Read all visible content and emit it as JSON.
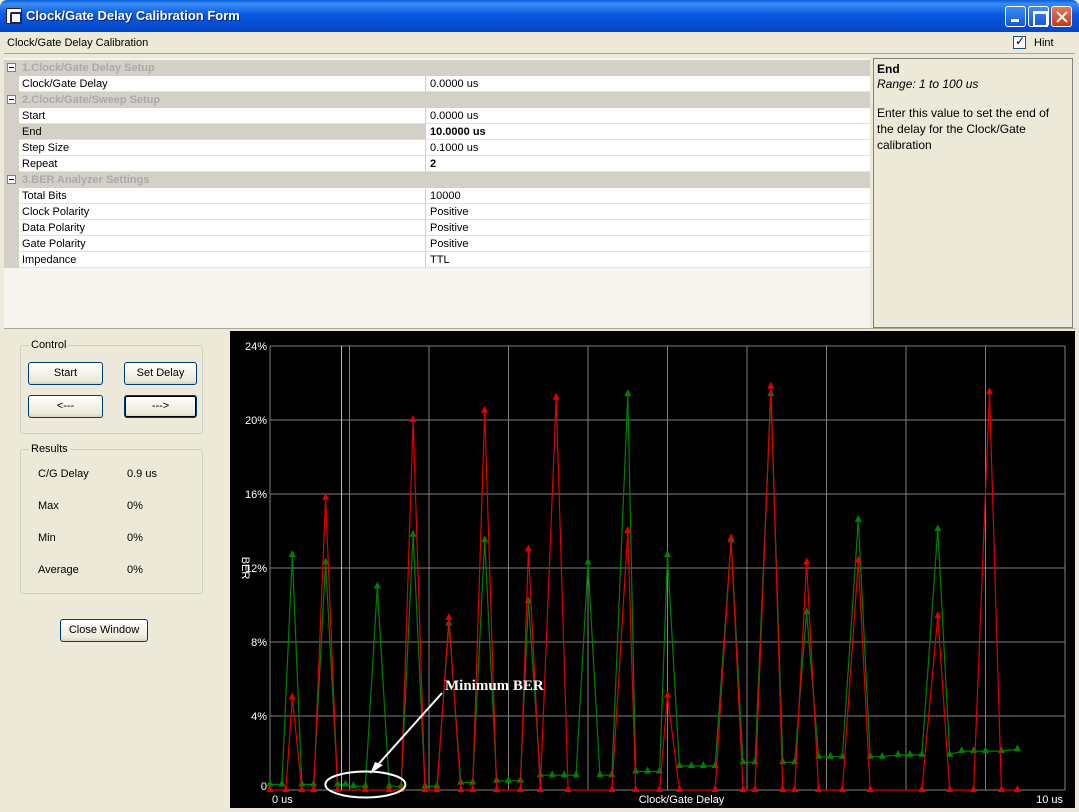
{
  "window": {
    "title": "Clock/Gate Delay Calibration Form"
  },
  "header": {
    "title": "Clock/Gate Delay Calibration",
    "hint_label": "Hint",
    "hint_checked": true
  },
  "propgrid": {
    "categories": [
      {
        "label": "1.Clock/Gate Delay Setup",
        "props": [
          {
            "name": "Clock/Gate Delay",
            "value": "0.0000 us"
          }
        ]
      },
      {
        "label": "2.Clock/Gate/Sweep Setup",
        "props": [
          {
            "name": "Start",
            "value": "0.0000 us"
          },
          {
            "name": "End",
            "value": "10.0000 us",
            "selected": true,
            "bold": true
          },
          {
            "name": "Step Size",
            "value": "0.1000 us"
          },
          {
            "name": "Repeat",
            "value": "2",
            "bold": true
          }
        ]
      },
      {
        "label": "3.BER Analyzer Settings",
        "props": [
          {
            "name": "Total Bits",
            "value": "10000"
          },
          {
            "name": "Clock Polarity",
            "value": "Positive"
          },
          {
            "name": "Data Polarity",
            "value": "Positive"
          },
          {
            "name": "Gate Polarity",
            "value": "Positive"
          },
          {
            "name": "Impedance",
            "value": "TTL"
          }
        ]
      }
    ]
  },
  "hint_panel": {
    "title": "End",
    "range": "Range: 1 to 100 us",
    "description": "Enter this value to set the end of the delay for the Clock/Gate calibration"
  },
  "control": {
    "title": "Control",
    "start_label": "Start",
    "set_delay_label": "Set Delay",
    "prev_label": "<---",
    "next_label": "--->"
  },
  "results": {
    "title": "Results",
    "items": [
      {
        "label": "C/G Delay",
        "value": "0.9 us"
      },
      {
        "label": "Max",
        "value": "0%"
      },
      {
        "label": "Min",
        "value": "0%"
      },
      {
        "label": "Average",
        "value": "0%"
      }
    ]
  },
  "close_button_label": "Close Window",
  "chart_data": {
    "type": "line",
    "xlabel": "Clock/Gate Delay",
    "ylabel": "BER",
    "xlim": [
      0,
      10
    ],
    "ylim": [
      0,
      24
    ],
    "x_tick_labels": [
      "0 us",
      "10 us"
    ],
    "y_ticks": [
      "0",
      "4%",
      "8%",
      "12%",
      "16%",
      "20%",
      "24%"
    ],
    "grid": true,
    "annotation": "Minimum BER",
    "marker_x": 0.9,
    "colors": {
      "green": "#008000",
      "red": "#e00000",
      "grid": "#808080",
      "marker": "#d8d800",
      "annotation": "#ffffff"
    },
    "series": [
      {
        "color": "green",
        "points": [
          [
            0,
            0.3
          ],
          [
            0.15,
            0.3
          ],
          [
            0.28,
            12.7
          ],
          [
            0.4,
            0.3
          ],
          [
            0.55,
            0.3
          ],
          [
            0.7,
            12.3
          ],
          [
            0.85,
            0.3
          ],
          [
            0.95,
            0.3
          ],
          [
            1.05,
            0.2
          ],
          [
            1.2,
            0.2
          ],
          [
            1.35,
            11
          ],
          [
            1.5,
            0.2
          ],
          [
            1.65,
            0.2
          ],
          [
            1.8,
            13.8
          ],
          [
            1.95,
            0.2
          ],
          [
            2.1,
            0.2
          ],
          [
            2.25,
            9
          ],
          [
            2.4,
            0.4
          ],
          [
            2.55,
            0.4
          ],
          [
            2.7,
            13.5
          ],
          [
            2.85,
            0.5
          ],
          [
            3.0,
            0.5
          ],
          [
            3.15,
            0.5
          ],
          [
            3.25,
            10.2
          ],
          [
            3.4,
            0.8
          ],
          [
            3.55,
            0.8
          ],
          [
            3.7,
            0.8
          ],
          [
            3.85,
            0.8
          ],
          [
            4.0,
            12.3
          ],
          [
            4.15,
            0.8
          ],
          [
            4.3,
            0.8
          ],
          [
            4.5,
            21.4
          ],
          [
            4.6,
            1.0
          ],
          [
            4.75,
            1.0
          ],
          [
            4.9,
            1.0
          ],
          [
            5.0,
            12.7
          ],
          [
            5.15,
            1.3
          ],
          [
            5.3,
            1.3
          ],
          [
            5.45,
            1.3
          ],
          [
            5.6,
            1.3
          ],
          [
            5.8,
            13.5
          ],
          [
            5.95,
            1.5
          ],
          [
            6.1,
            1.5
          ],
          [
            6.3,
            21.4
          ],
          [
            6.45,
            1.5
          ],
          [
            6.6,
            1.5
          ],
          [
            6.75,
            9.6
          ],
          [
            6.9,
            1.8
          ],
          [
            7.05,
            1.8
          ],
          [
            7.2,
            1.8
          ],
          [
            7.4,
            14.6
          ],
          [
            7.55,
            1.8
          ],
          [
            7.7,
            1.8
          ],
          [
            7.9,
            1.9
          ],
          [
            8.05,
            1.9
          ],
          [
            8.2,
            1.9
          ],
          [
            8.4,
            14.1
          ],
          [
            8.55,
            1.9
          ],
          [
            8.7,
            2.1
          ],
          [
            8.85,
            2.1
          ],
          [
            9.0,
            2.1
          ],
          [
            9.2,
            2.1
          ],
          [
            9.4,
            2.2
          ]
        ]
      },
      {
        "color": "red",
        "points": [
          [
            0,
            0
          ],
          [
            0.2,
            0
          ],
          [
            0.28,
            5
          ],
          [
            0.4,
            0
          ],
          [
            0.55,
            0
          ],
          [
            0.7,
            15.8
          ],
          [
            0.85,
            0
          ],
          [
            1.2,
            0
          ],
          [
            1.5,
            0
          ],
          [
            1.65,
            0
          ],
          [
            1.8,
            20
          ],
          [
            1.95,
            0
          ],
          [
            2.1,
            0
          ],
          [
            2.25,
            9.3
          ],
          [
            2.4,
            0
          ],
          [
            2.55,
            0
          ],
          [
            2.7,
            20.5
          ],
          [
            2.85,
            0
          ],
          [
            3.15,
            0
          ],
          [
            3.25,
            13
          ],
          [
            3.4,
            0
          ],
          [
            3.6,
            21.2
          ],
          [
            3.75,
            0
          ],
          [
            4.3,
            0
          ],
          [
            4.5,
            14
          ],
          [
            4.6,
            0
          ],
          [
            4.9,
            0
          ],
          [
            5.0,
            5.1
          ],
          [
            5.15,
            0
          ],
          [
            5.6,
            0
          ],
          [
            5.8,
            13.6
          ],
          [
            5.95,
            0
          ],
          [
            6.1,
            0
          ],
          [
            6.3,
            21.8
          ],
          [
            6.45,
            0
          ],
          [
            6.6,
            0
          ],
          [
            6.75,
            12.3
          ],
          [
            6.9,
            0
          ],
          [
            7.2,
            0
          ],
          [
            7.4,
            12.4
          ],
          [
            7.55,
            0
          ],
          [
            8.2,
            0
          ],
          [
            8.4,
            9.4
          ],
          [
            8.55,
            0
          ],
          [
            8.85,
            0
          ],
          [
            9.05,
            21.5
          ],
          [
            9.2,
            0
          ],
          [
            9.4,
            0
          ]
        ]
      }
    ]
  }
}
